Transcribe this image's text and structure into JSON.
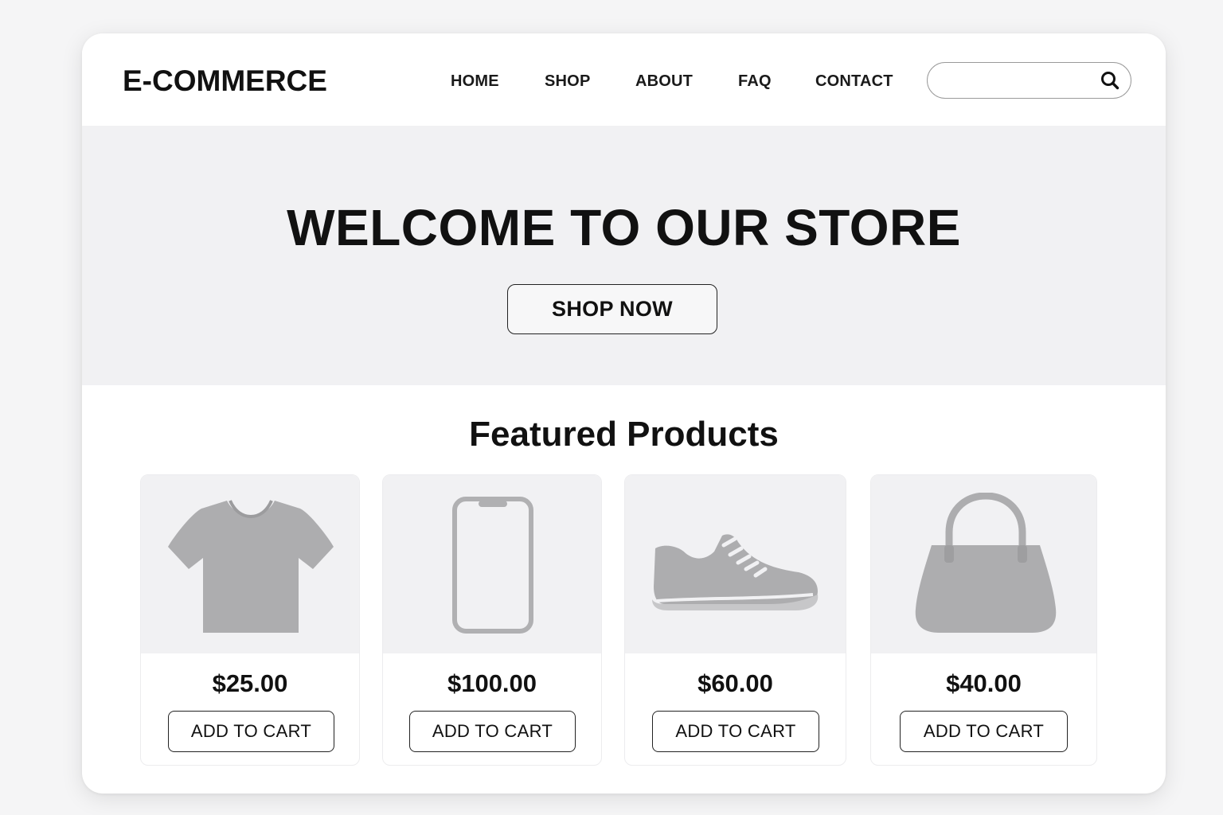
{
  "header": {
    "logo": "E-COMMERCE",
    "nav": [
      {
        "label": "HOME"
      },
      {
        "label": "SHOP"
      },
      {
        "label": "ABOUT"
      },
      {
        "label": "FAQ"
      },
      {
        "label": "CONTACT"
      }
    ],
    "search": {
      "value": "",
      "placeholder": "",
      "icon": "search-icon"
    }
  },
  "hero": {
    "title": "WELCOME TO OUR STORE",
    "button_label": "SHOP NOW"
  },
  "featured": {
    "title": "Featured Products",
    "products": [
      {
        "icon": "tshirt-icon",
        "price": "$25.00",
        "button_label": "ADD TO CART"
      },
      {
        "icon": "smartphone-icon",
        "price": "$100.00",
        "button_label": "ADD TO CART"
      },
      {
        "icon": "sneaker-icon",
        "price": "$60.00",
        "button_label": "ADD TO CART"
      },
      {
        "icon": "handbag-icon",
        "price": "$40.00",
        "button_label": "ADD TO CART"
      }
    ]
  },
  "colors": {
    "page_bg": "#f5f5f6",
    "hero_bg": "#f1f1f3",
    "icon_gray": "#adadaf",
    "text": "#111111"
  }
}
